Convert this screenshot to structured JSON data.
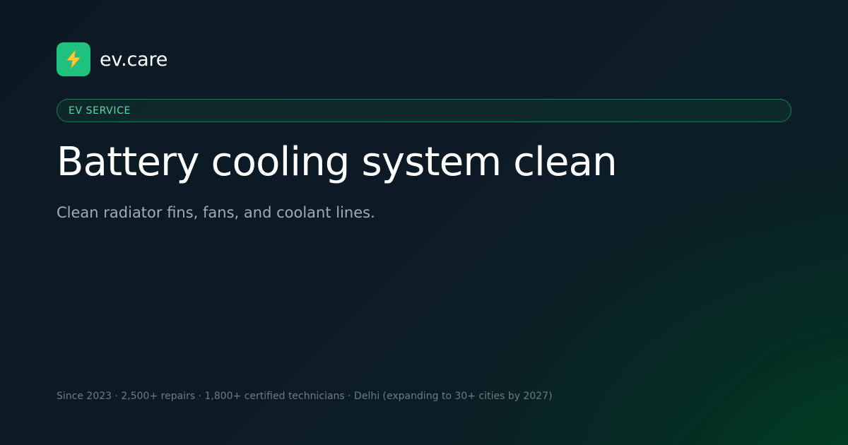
{
  "brand": {
    "name": "ev.care",
    "icon": "lightning-bolt-icon",
    "accent_color": "#1ec27e"
  },
  "category": {
    "label": "EV SERVICE"
  },
  "hero": {
    "title": "Battery cooling system clean",
    "subtitle": "Clean radiator fins, fans, and coolant lines."
  },
  "footer": {
    "meta": "Since 2023 · 2,500+ repairs · 1,800+ certified technicians · Delhi (expanding to 30+ cities by 2027)"
  }
}
